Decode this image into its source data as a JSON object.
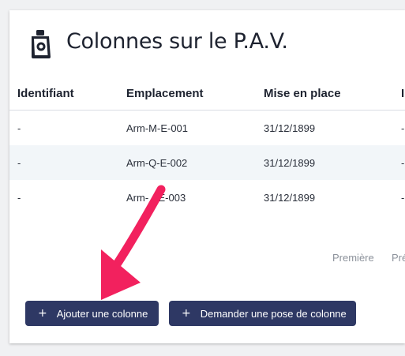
{
  "header": {
    "title": "Colonnes sur le P.A.V.",
    "icon": "column-container-icon"
  },
  "table": {
    "columns": [
      "Identifiant",
      "Emplacement",
      "Mise en place",
      "I"
    ],
    "rows": [
      {
        "identifiant": "-",
        "emplacement": "Arm-M-E-001",
        "mise_en_place": "31/12/1899",
        "extra": "-"
      },
      {
        "identifiant": "-",
        "emplacement": "Arm-Q-E-002",
        "mise_en_place": "31/12/1899",
        "extra": "-"
      },
      {
        "identifiant": "-",
        "emplacement": "Arm-",
        "emplacement_tail": "-E-003",
        "mise_en_place": "31/12/1899",
        "extra": "-"
      }
    ]
  },
  "pagination": {
    "first": "Première",
    "previous": "Pré"
  },
  "actions": {
    "add_column": "Ajouter une colonne",
    "request_column": "Demander une pose de colonne",
    "plus_glyph": "+"
  },
  "colors": {
    "button_bg": "#2e3864",
    "arrow": "#f2215e",
    "row_alt": "#f2f6f9"
  }
}
